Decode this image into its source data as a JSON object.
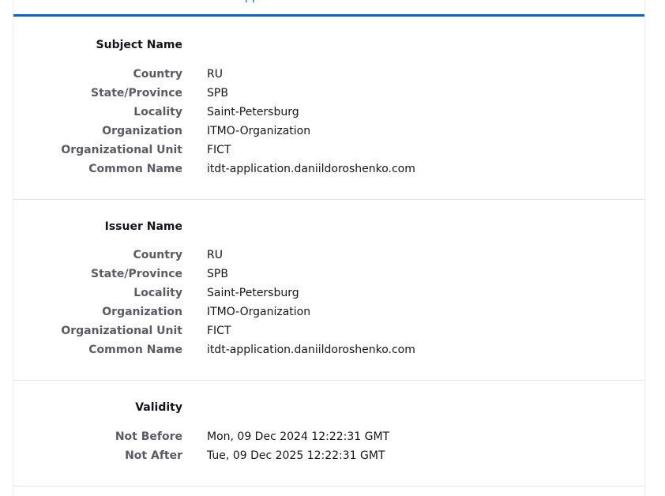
{
  "tab": {
    "fragment": "pp"
  },
  "subject": {
    "title": "Subject Name",
    "fields": [
      {
        "label": "Country",
        "value": "RU"
      },
      {
        "label": "State/Province",
        "value": "SPB"
      },
      {
        "label": "Locality",
        "value": "Saint-Petersburg"
      },
      {
        "label": "Organization",
        "value": "ITMO-Organization"
      },
      {
        "label": "Organizational Unit",
        "value": "FICT"
      },
      {
        "label": "Common Name",
        "value": "itdt-application.daniildoroshenko.com"
      }
    ]
  },
  "issuer": {
    "title": "Issuer Name",
    "fields": [
      {
        "label": "Country",
        "value": "RU"
      },
      {
        "label": "State/Province",
        "value": "SPB"
      },
      {
        "label": "Locality",
        "value": "Saint-Petersburg"
      },
      {
        "label": "Organization",
        "value": "ITMO-Organization"
      },
      {
        "label": "Organizational Unit",
        "value": "FICT"
      },
      {
        "label": "Common Name",
        "value": "itdt-application.daniildoroshenko.com"
      }
    ]
  },
  "validity": {
    "title": "Validity",
    "fields": [
      {
        "label": "Not Before",
        "value": "Mon, 09 Dec 2024 12:22:31 GMT"
      },
      {
        "label": "Not After",
        "value": "Tue, 09 Dec 2025 12:22:31 GMT"
      }
    ]
  },
  "colors": {
    "accent": "#0a64c8",
    "label": "#5b5b66",
    "text": "#15141a",
    "divider": "#e1e1e6"
  }
}
